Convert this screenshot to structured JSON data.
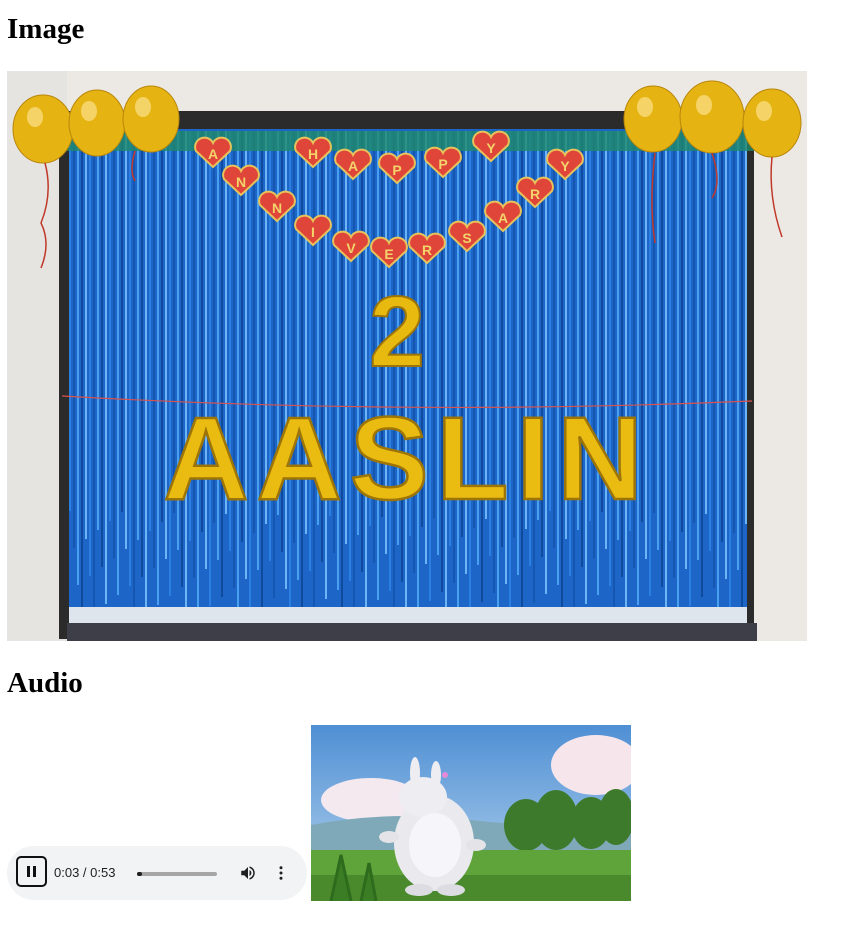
{
  "headings": {
    "image": "Image",
    "audio": "Audio"
  },
  "photo": {
    "banner_letters": [
      "A",
      "N",
      "N",
      "I",
      "V",
      "E",
      "R",
      "S",
      "A",
      "R",
      "Y",
      "H",
      "A",
      "P",
      "P",
      "Y"
    ],
    "big_number": "2",
    "name_balloons": "AASLIN",
    "colors": {
      "curtain": "#1f6fd0",
      "balloon_gold": "#e7b80f",
      "heart_red": "#e0453a",
      "wall": "#ece9e4"
    }
  },
  "audio_player": {
    "state_icon": "pause-icon",
    "current_time": "0:03",
    "separator": " / ",
    "duration": "0:53",
    "progress_fraction": 0.06,
    "volume_icon": "volume-icon",
    "menu_icon": "more-vert-icon"
  },
  "video": {
    "thumbnail_subject": "big-white-rabbit-in-meadow"
  }
}
